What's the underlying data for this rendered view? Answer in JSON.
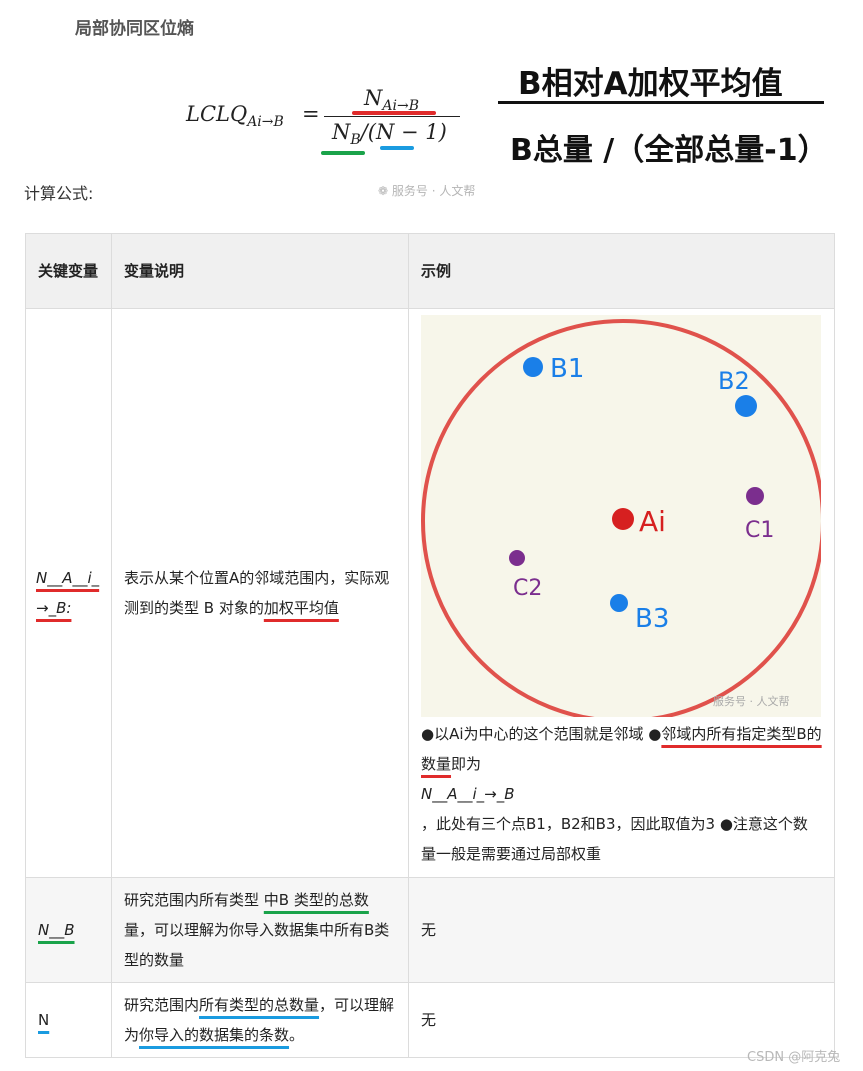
{
  "heading": "局部协同区位熵",
  "formula": {
    "lhs_main": "LCLQ",
    "lhs_sub": "Ai→B",
    "equals": "=",
    "numerator_main": "N",
    "numerator_sub": "Ai→B",
    "denominator_main": "N",
    "denominator_sub": "B",
    "denominator_rest": "/(N − 1)"
  },
  "annotation": {
    "top": "B相对A加权平均值",
    "bottom": "B总量 /（全部总量-1）"
  },
  "calc_label": "计算公式:",
  "watermark": "服务号 · 人文帮",
  "table": {
    "headers": [
      "关键变量",
      "变量说明",
      "示例"
    ],
    "row1": {
      "var": "N__A__i_→_B:",
      "desc_a": "表示从某个位置A的邻域范围内，实际观测到的类型 B 对象的",
      "desc_b": "加权平均值",
      "ex_a": "●以Ai为中心的这个范围就是邻域 ●",
      "ex_b": "邻域内所有指定类型B的数量",
      "ex_c": "即为",
      "ex_var": "N__A__i_→_B",
      "ex_d": "，此处有三个点B1，B2和B3，因此取值为3 ●注意这个数量一般是需要通过局部权重"
    },
    "row2": {
      "var": "N__B",
      "desc_a": "研究范围内所有类型",
      "desc_b": "中B 类型的总数",
      "desc_c": "量，可以理解为你导入数据集中所有B类型的数量",
      "example": "无"
    },
    "row3": {
      "var": "N",
      "desc_a": "研究范围内",
      "desc_b": "所有类型的总数量",
      "desc_c": "，可以理解为",
      "desc_d": "你导入的数据集的条数",
      "desc_e": "。",
      "example": "无"
    }
  },
  "diagram": {
    "labels": {
      "a": "Ai",
      "b1": "B1",
      "b2": "B2",
      "b3": "B3",
      "c1": "C1",
      "c2": "C2"
    },
    "colors": {
      "circle": "#e0524c",
      "a": "#d62020",
      "b": "#1a7fe8",
      "c": "#7b2e8e",
      "bg": "#f7f6ea"
    }
  },
  "footer": "CSDN @阿克兔"
}
